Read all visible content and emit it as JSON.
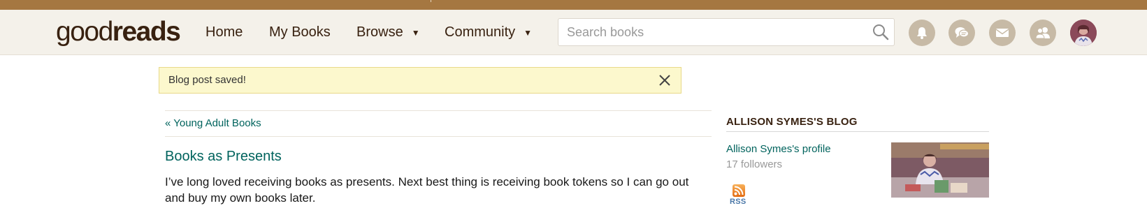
{
  "header": {
    "logo": {
      "part1": "good",
      "part2": "reads"
    },
    "nav": {
      "home": "Home",
      "my_books": "My Books",
      "browse": "Browse",
      "community": "Community",
      "caret": "▼"
    },
    "search": {
      "placeholder": "Search books",
      "icon": "search-icon"
    },
    "icons": [
      "bell-icon",
      "discussion-icon",
      "mail-icon",
      "friends-icon",
      "user-avatar"
    ]
  },
  "flash": {
    "message": "Blog post saved!",
    "close_icon": "close-icon"
  },
  "post": {
    "back_link": "« Young Adult Books",
    "title": "Books as Presents",
    "body": "I’ve long loved receiving books as presents. Next best thing is receiving book tokens so I can go out and buy my own books later."
  },
  "sidebar": {
    "heading": "ALLISON SYMES'S BLOG",
    "profile_link": "Allison Symes's profile",
    "followers": "17 followers",
    "rss_label": "RSS"
  },
  "colors": {
    "top_strip": "#a57741",
    "header_bg": "#f4f1ea",
    "brand_dark": "#382110",
    "link_teal": "#00635d",
    "flash_bg": "#fcf8cd",
    "icon_circle": "#c7baa6"
  }
}
